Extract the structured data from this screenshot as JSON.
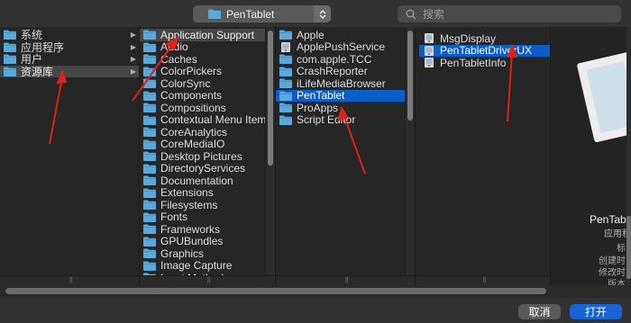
{
  "toolbar": {
    "path_label": "PenTablet",
    "search_placeholder": "搜索"
  },
  "columns": [
    {
      "items": [
        {
          "label": "系统",
          "icon": "folder-icon",
          "chevron": true
        },
        {
          "label": "应用程序",
          "icon": "folder-icon",
          "chevron": true
        },
        {
          "label": "用户",
          "icon": "folder-icon",
          "chevron": true
        },
        {
          "label": "资源库",
          "icon": "folder-icon",
          "chevron": true,
          "selected": "gray"
        }
      ]
    },
    {
      "items": [
        {
          "label": "Application Support",
          "icon": "folder-icon",
          "chevron": true,
          "selected": "gray"
        },
        {
          "label": "Audio",
          "icon": "folder-icon",
          "chevron": true
        },
        {
          "label": "Caches",
          "icon": "folder-icon",
          "chevron": true
        },
        {
          "label": "ColorPickers",
          "icon": "folder-icon",
          "chevron": true
        },
        {
          "label": "ColorSync",
          "icon": "folder-icon",
          "chevron": true
        },
        {
          "label": "Components",
          "icon": "folder-icon",
          "chevron": true
        },
        {
          "label": "Compositions",
          "icon": "folder-icon",
          "chevron": true
        },
        {
          "label": "Contextual Menu Items",
          "icon": "folder-icon",
          "chevron": true
        },
        {
          "label": "CoreAnalytics",
          "icon": "folder-icon",
          "chevron": true
        },
        {
          "label": "CoreMediaIO",
          "icon": "folder-icon",
          "chevron": true
        },
        {
          "label": "Desktop Pictures",
          "icon": "folder-icon",
          "chevron": true
        },
        {
          "label": "DirectoryServices",
          "icon": "folder-icon",
          "chevron": true
        },
        {
          "label": "Documentation",
          "icon": "folder-icon",
          "chevron": true
        },
        {
          "label": "Extensions",
          "icon": "folder-icon",
          "chevron": true
        },
        {
          "label": "Filesystems",
          "icon": "folder-icon",
          "chevron": true
        },
        {
          "label": "Fonts",
          "icon": "folder-icon",
          "chevron": true
        },
        {
          "label": "Frameworks",
          "icon": "folder-icon",
          "chevron": true
        },
        {
          "label": "GPUBundles",
          "icon": "folder-icon",
          "chevron": true
        },
        {
          "label": "Graphics",
          "icon": "folder-icon",
          "chevron": true
        },
        {
          "label": "Image Capture",
          "icon": "folder-icon",
          "chevron": true
        },
        {
          "label": "Input Methods",
          "icon": "folder-icon",
          "chevron": true
        }
      ]
    },
    {
      "items": [
        {
          "label": "Apple",
          "icon": "folder-icon",
          "chevron": true
        },
        {
          "label": "ApplePushService",
          "icon": "app-icon",
          "chevron": false
        },
        {
          "label": "com.apple.TCC",
          "icon": "folder-icon",
          "chevron": true
        },
        {
          "label": "CrashReporter",
          "icon": "folder-icon",
          "chevron": true
        },
        {
          "label": "iLifeMediaBrowser",
          "icon": "folder-icon",
          "chevron": true
        },
        {
          "label": "PenTablet",
          "icon": "folder-icon",
          "chevron": true,
          "selected": "blue"
        },
        {
          "label": "ProApps",
          "icon": "folder-icon",
          "chevron": true
        },
        {
          "label": "Script Editor",
          "icon": "folder-icon",
          "chevron": true
        }
      ]
    },
    {
      "items": [
        {
          "label": "MsgDisplay",
          "icon": "app-icon",
          "chevron": false
        },
        {
          "label": "PenTabletDriverUX",
          "icon": "app-icon",
          "chevron": false,
          "selected": "blue"
        },
        {
          "label": "PenTabletInfo",
          "icon": "app-icon",
          "chevron": false
        }
      ]
    }
  ],
  "preview": {
    "name": "PenTablet",
    "kind": "应用程",
    "meta": [
      "标",
      "创建时",
      "修改时",
      "版本"
    ]
  },
  "buttons": {
    "cancel": "取消",
    "open": "打开"
  },
  "colors": {
    "selection_blue": "#0a5ec9",
    "selection_gray": "#464646",
    "folder_blue": "#5aa9dd",
    "annotation_arrow": "#e0201a",
    "open_button": "#1565d4"
  }
}
